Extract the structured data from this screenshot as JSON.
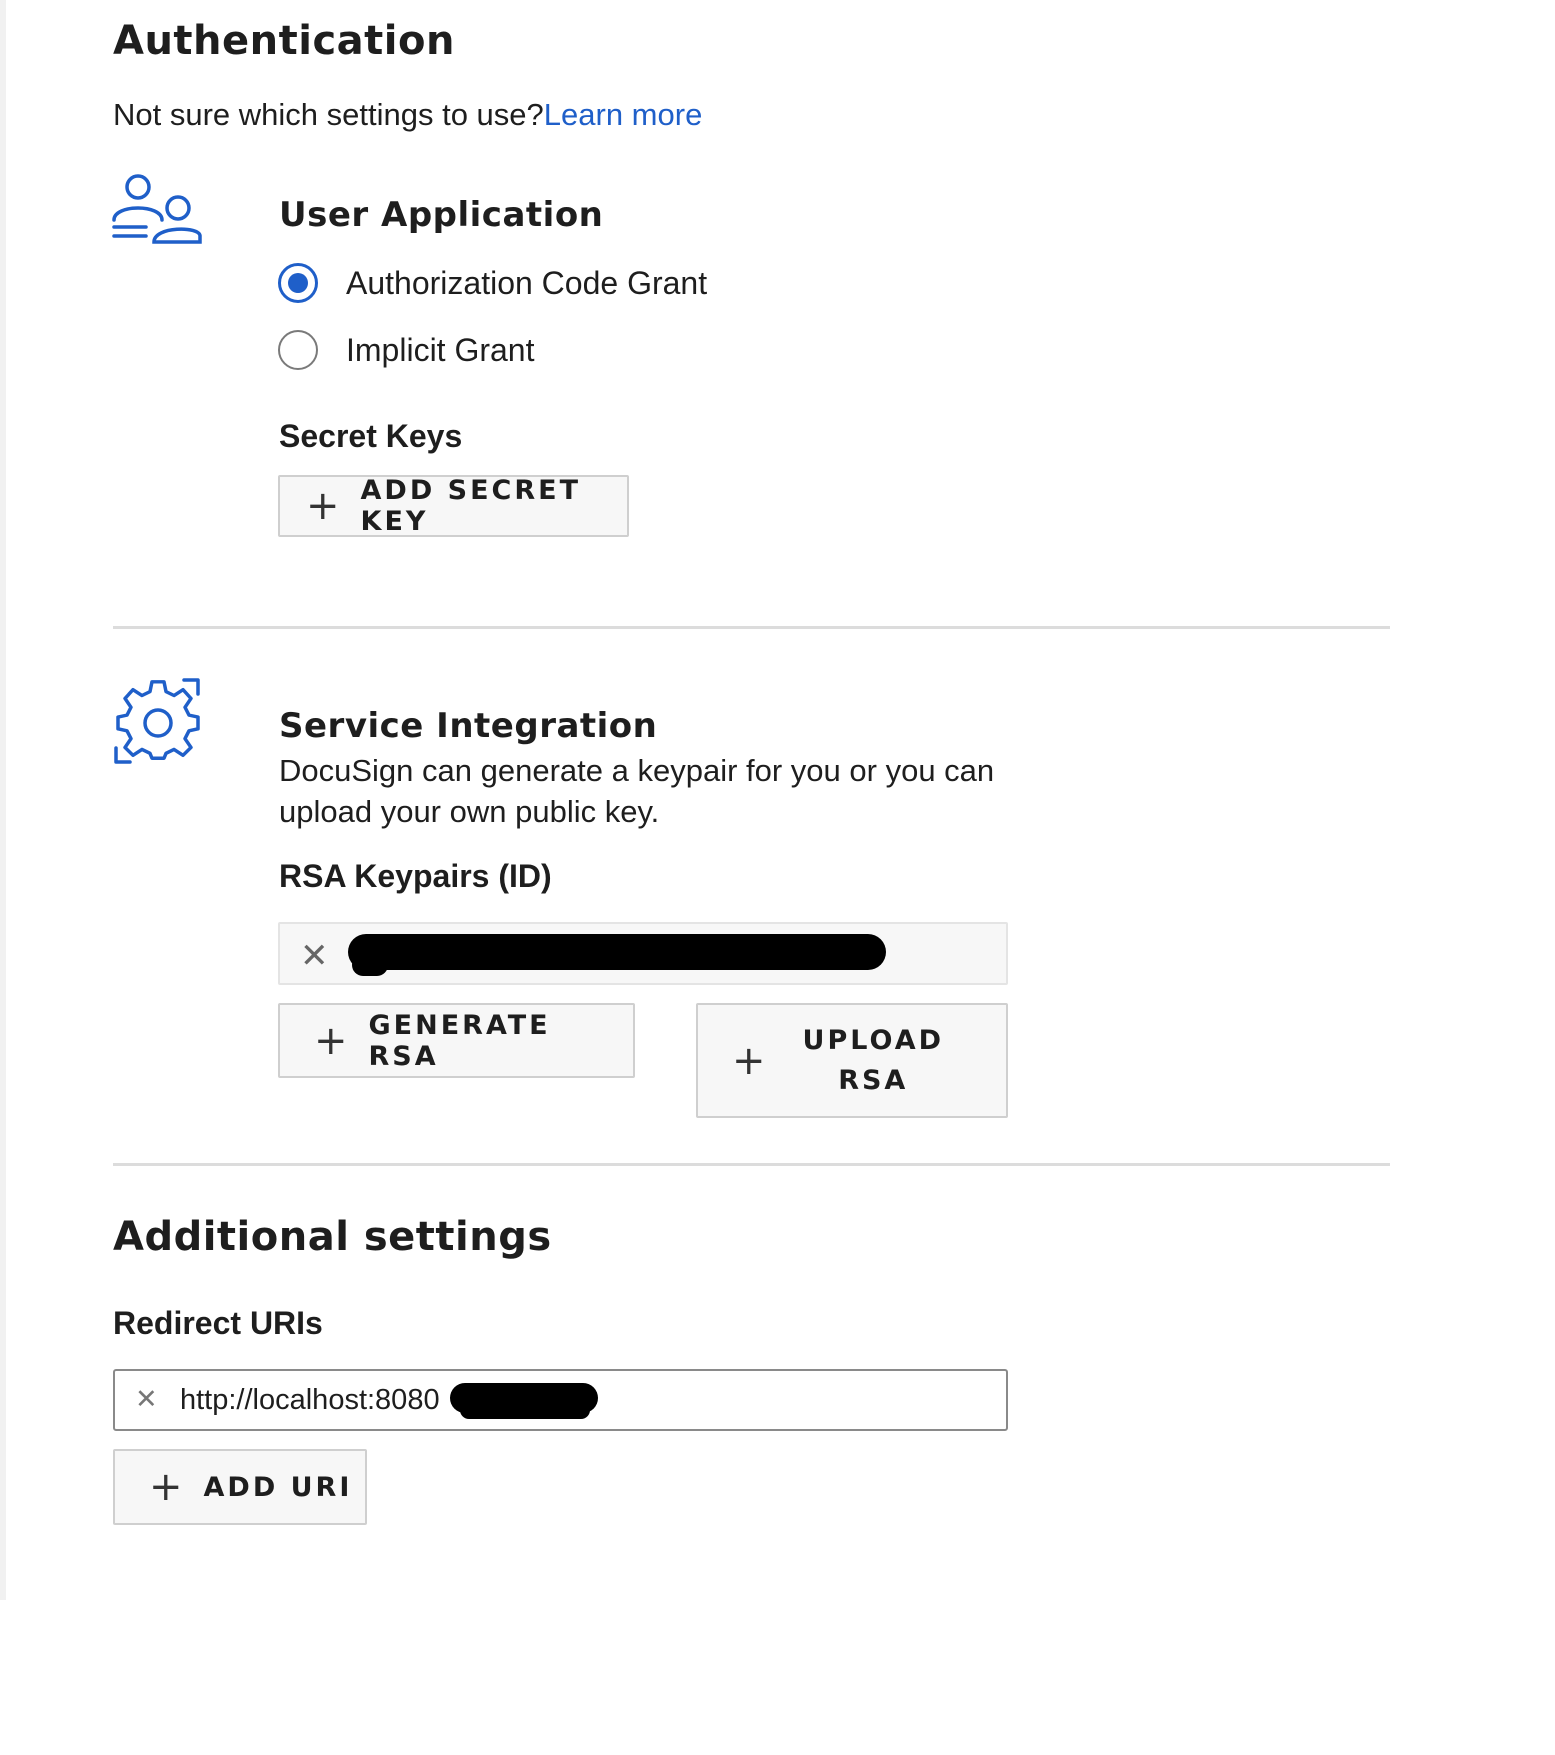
{
  "auth": {
    "title": "Authentication",
    "help_text": "Not sure which settings to use?",
    "help_link": "Learn more"
  },
  "user_app": {
    "icon": "users-icon",
    "title": "User Application",
    "options": [
      {
        "label": "Authorization Code Grant",
        "checked": true
      },
      {
        "label": "Implicit Grant",
        "checked": false
      }
    ],
    "secret_keys_label": "Secret Keys",
    "add_secret_key": "ADD SECRET KEY"
  },
  "service": {
    "icon": "gear-icon",
    "title": "Service Integration",
    "description_line1": "DocuSign can generate a keypair for you or you can",
    "description_line2": "upload your own public key.",
    "rsa_label": "RSA Keypairs (ID)",
    "generate_rsa": "GENERATE RSA",
    "upload_rsa_line1": "UPLOAD",
    "upload_rsa_line2": "RSA"
  },
  "additional": {
    "title": "Additional settings",
    "redirect_label": "Redirect URIs",
    "redirect_value": "http://localhost:8080",
    "add_uri": "ADD URI"
  },
  "colors": {
    "accent": "#1f5fc9",
    "text": "#1e1e1e",
    "button_bg": "#f7f7f7"
  }
}
